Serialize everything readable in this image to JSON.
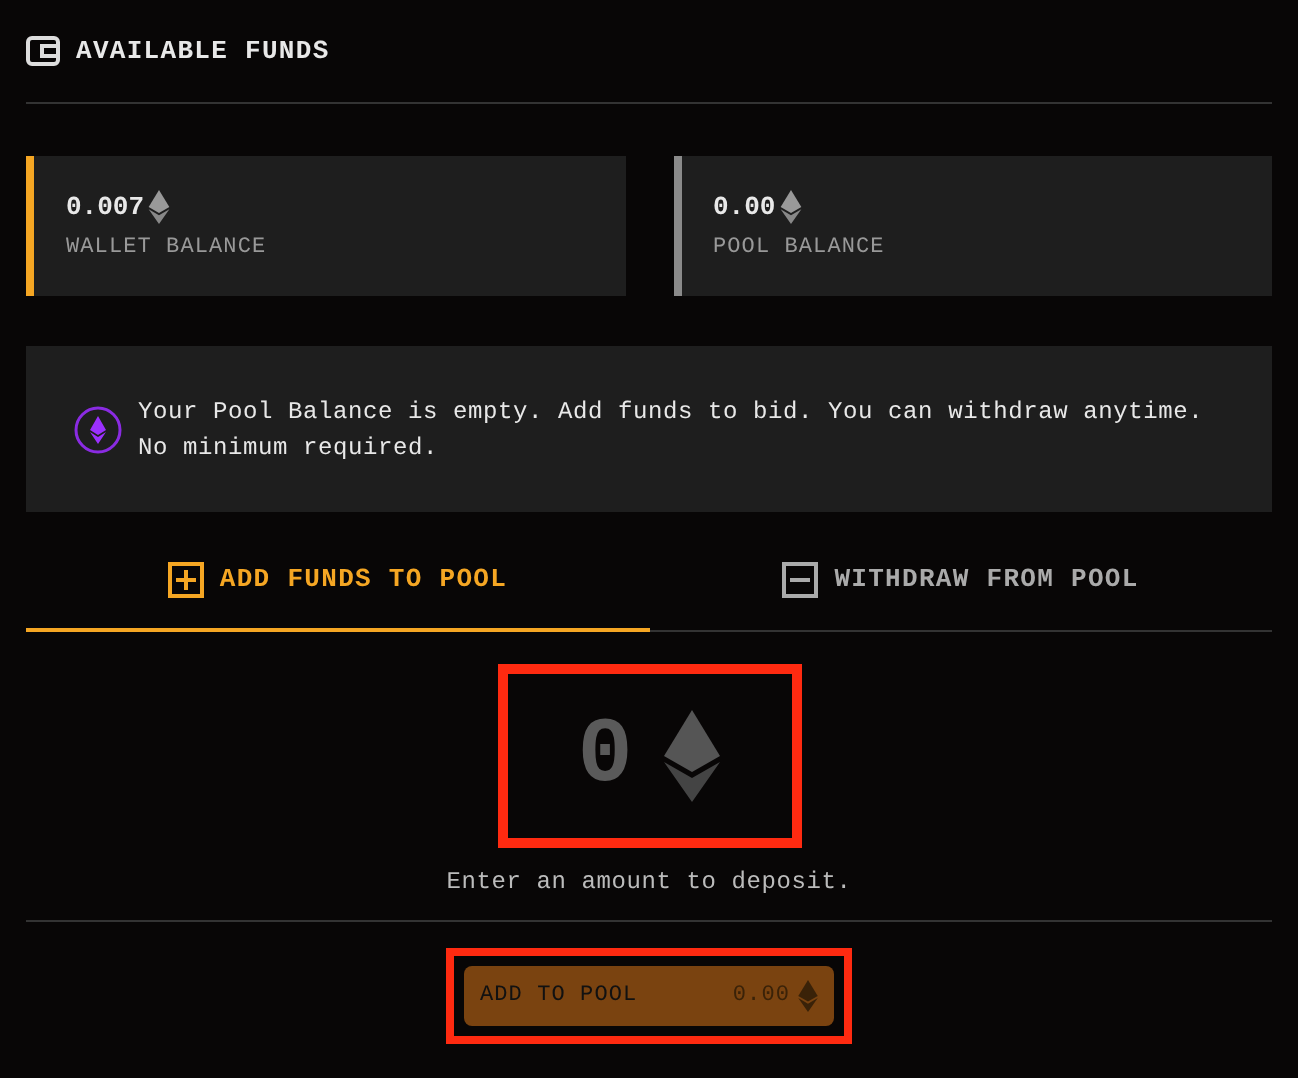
{
  "header": {
    "title": "AVAILABLE FUNDS"
  },
  "balances": [
    {
      "amount": "0.007",
      "label": "WALLET BALANCE",
      "color": "#f5a623"
    },
    {
      "amount": "0.00",
      "label": "POOL BALANCE",
      "color": "#8a8a8a"
    }
  ],
  "notice": {
    "text": "Your Pool Balance is empty. Add funds to bid. You can withdraw anytime. No minimum required."
  },
  "tabs": [
    {
      "label": "ADD FUNDS TO POOL",
      "kind": "plus",
      "selected": true
    },
    {
      "label": "WITHDRAW FROM POOL",
      "kind": "minus",
      "selected": false
    }
  ],
  "amount": {
    "value": "0",
    "hint": "Enter an amount to deposit.",
    "highlighted": true
  },
  "submit": {
    "label": "ADD TO POOL",
    "amount": "0.00",
    "highlighted": true
  }
}
